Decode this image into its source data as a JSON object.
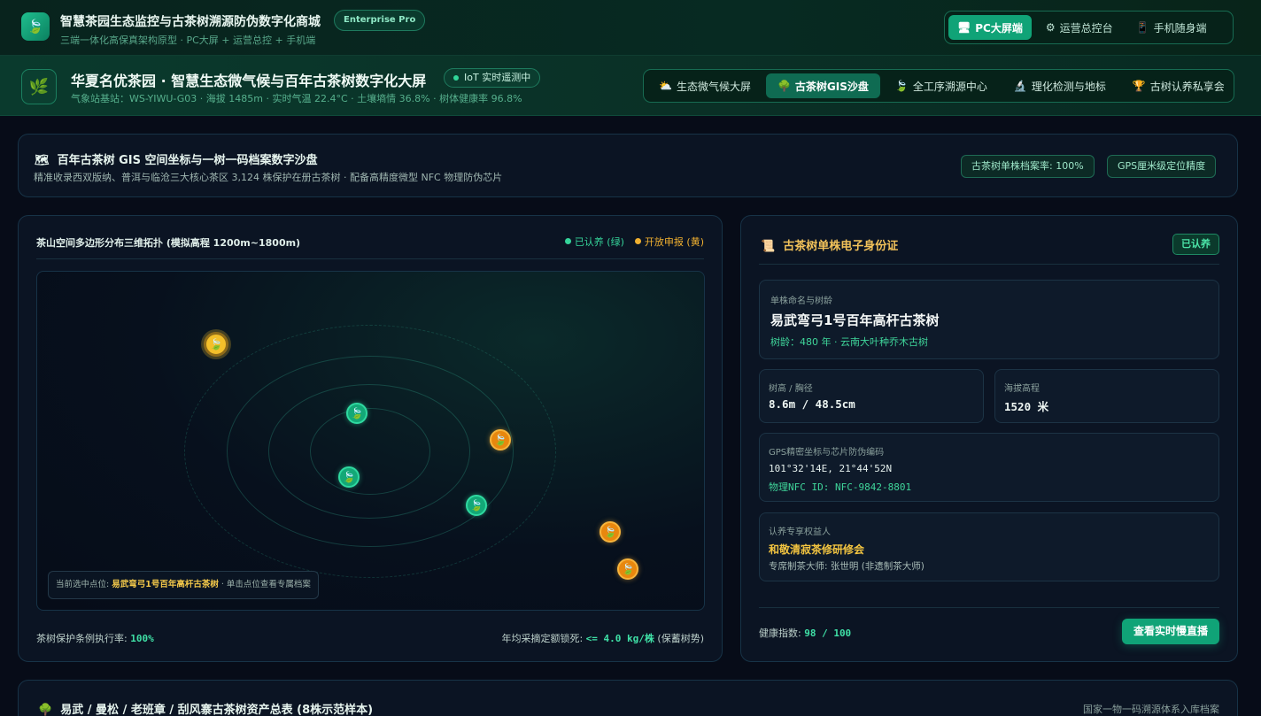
{
  "app": {
    "title": "智慧茶园生态监控与古茶树溯源防伪数字化商城",
    "badge": "Enterprise Pro",
    "subtitle": "三端一体化高保真架构原型 · PC大屏 + 运营总控 + 手机端",
    "modes": [
      {
        "label": "PC大屏端",
        "icon": "monitor-icon",
        "glyph": "🖥",
        "active": true
      },
      {
        "label": "运营总控台",
        "icon": "gear-icon",
        "glyph": "⚙",
        "active": false
      },
      {
        "label": "手机随身端",
        "icon": "phone-icon",
        "glyph": "📱",
        "active": false
      }
    ]
  },
  "header": {
    "title": "华夏名优茶园 · 智慧生态微气候与百年古茶树数字化大屏",
    "iot_status": "IoT 实时遥测中",
    "station": "气象站基站：WS-YIWU-G03 · 海拔 1485m · 实时气温 22.4°C · 土壤墒情 36.8% · 树体健康率 96.8%",
    "tabs": [
      {
        "label": "生态微气候大屏",
        "icon": "sun-cloud-icon",
        "glyph": "⛅",
        "active": false
      },
      {
        "label": "古茶树GIS沙盘",
        "icon": "tree-icon",
        "glyph": "🌳",
        "active": true
      },
      {
        "label": "全工序溯源中心",
        "icon": "leaf-icon",
        "glyph": "🍃",
        "active": false
      },
      {
        "label": "理化检测与地标",
        "icon": "microscope-icon",
        "glyph": "🔬",
        "active": false
      },
      {
        "label": "古树认养私享会",
        "icon": "trophy-icon",
        "glyph": "🏆",
        "active": false
      }
    ]
  },
  "banner": {
    "title": "百年古茶树 GIS 空间坐标与一树一码档案数字沙盘",
    "subtitle": "精准收录西双版纳、普洱与临沧三大核心茶区 3,124 株保护在册古茶树 · 配备高精度微型 NFC 物理防伪芯片",
    "chips": [
      "古茶树单株档案率: 100%",
      "GPS厘米级定位精度"
    ]
  },
  "map_panel": {
    "title": "茶山空间多边形分布三维拓扑 (模拟高程 1200m~1800m)",
    "legend_adopted": "已认养 (绿)",
    "legend_open": "开放申报 (黄)",
    "colors": {
      "adopted": "#13a877",
      "open": "#e8870e"
    },
    "selected_prefix": "当前选中点位: ",
    "selected_name": "易武弯弓1号百年高杆古茶树",
    "selected_suffix": " · 单击点位查看专属档案",
    "footer_left_label": "茶树保护条例执行率: ",
    "footer_left_value": "100%",
    "footer_right_label": "年均采摘定额锁死: ",
    "footer_right_value": "<= 4.0 kg/株",
    "footer_right_suffix": " (保蓄树势)"
  },
  "tree_card": {
    "title": "古茶树单株电子身份证",
    "status": "已认养",
    "name_label": "单株命名与树龄",
    "name": "易武弯弓1号百年高杆古茶树",
    "age": "树龄：480 年 · 云南大叶种乔木古树",
    "size_label": "树高 / 胸径",
    "size_value": "8.6m / 48.5cm",
    "alt_label": "海拔高程",
    "alt_value": "1520 米",
    "gps_label": "GPS精密坐标与芯片防伪编码",
    "gps_value": "101°32'14E, 21°44'52N",
    "nfc_value": "物理NFC ID: NFC-9842-8801",
    "owner_label": "认养专享权益人",
    "owner": "和敬清寂茶修研修会",
    "master": "专席制茶大师: 张世明 (非遗制茶大师)",
    "health_label": "健康指数: ",
    "health_value": "98 / 100",
    "live_button": "查看实时慢直播"
  },
  "assets": {
    "title": "易武 / 曼松 / 老班章 / 刮风寨古茶树资产总表 (8株示范样本)",
    "right_text": "国家一物一码溯源体系入库档案"
  }
}
